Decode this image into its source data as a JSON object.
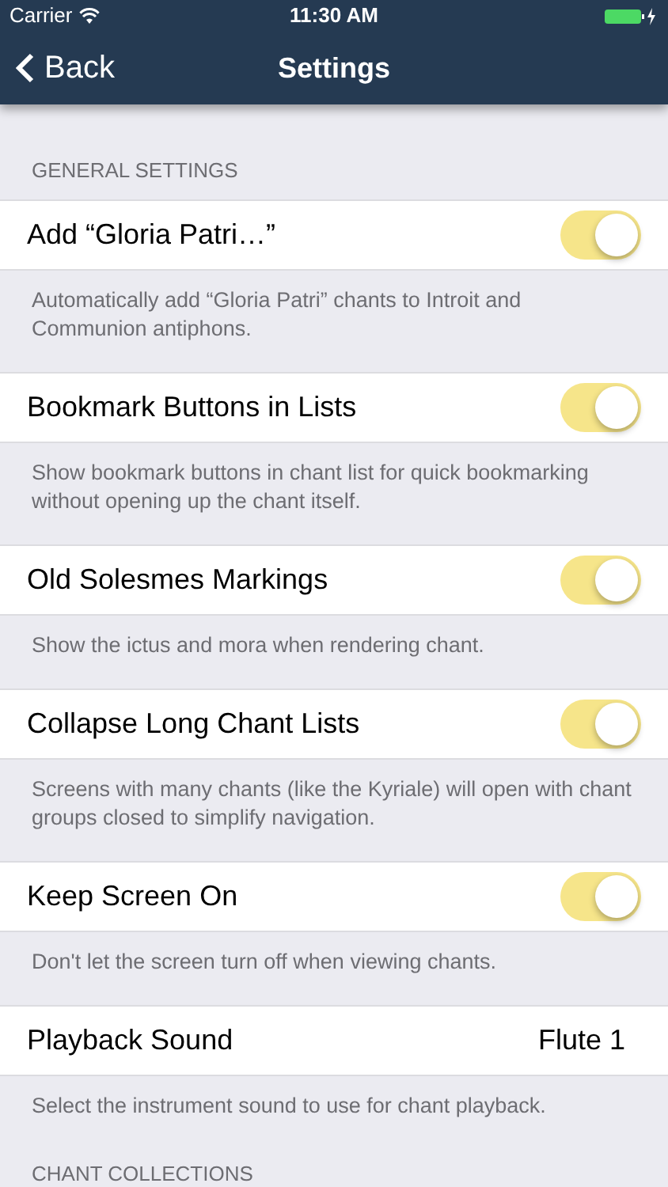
{
  "status_bar": {
    "carrier": "Carrier",
    "time": "11:30 AM"
  },
  "nav": {
    "back": "Back",
    "title": "Settings"
  },
  "sections": [
    {
      "header": "GENERAL SETTINGS",
      "items": [
        {
          "kind": "toggle",
          "label": "Add “Gloria Patri…”",
          "on": true,
          "description": "Automatically add “Gloria Patri” chants to Introit and Communion antiphons."
        },
        {
          "kind": "toggle",
          "label": "Bookmark Buttons in Lists",
          "on": true,
          "description": "Show bookmark buttons in chant list for quick bookmarking without opening up the chant itself."
        },
        {
          "kind": "toggle",
          "label": "Old Solesmes Markings",
          "on": true,
          "description": "Show the ictus and mora when rendering chant."
        },
        {
          "kind": "toggle",
          "label": "Collapse Long Chant Lists",
          "on": true,
          "description": "Screens with many chants (like the Kyriale) will open with chant groups closed to simplify navigation."
        },
        {
          "kind": "toggle",
          "label": "Keep Screen On",
          "on": true,
          "description": "Don't let the screen turn off when viewing chants."
        },
        {
          "kind": "value",
          "label": "Playback Sound",
          "value": "Flute 1",
          "description": "Select the instrument sound to use for chant playback."
        }
      ]
    },
    {
      "header": "CHANT COLLECTIONS"
    }
  ]
}
